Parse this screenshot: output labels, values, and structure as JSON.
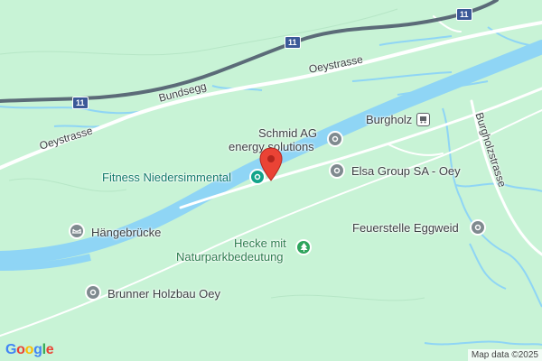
{
  "map": {
    "roads": {
      "oeystrasse_left": "Oeystrasse",
      "bundsegg": "Bundsegg",
      "oeystrasse_top": "Oeystrasse",
      "burgholzstrasse": "Burgholzstrasse"
    },
    "shields": [
      "11",
      "11",
      "11"
    ],
    "places": {
      "burgholz": "Burgholz",
      "schmid_line1": "Schmid AG",
      "schmid_line2": "energy solutions",
      "fitness": "Fitness Niedersimmental",
      "elsa": "Elsa Group SA - Oey",
      "feuerstelle": "Feuerstelle Eggweid",
      "haengebruecke": "Hängebrücke",
      "hecke_line1": "Hecke mit",
      "hecke_line2": "Naturparkbedeutung",
      "brunner": "Brunner Holzbau Oey"
    },
    "icons": {
      "schmid": "location-pin-icon",
      "fitness": "fitness-icon",
      "elsa": "location-pin-icon",
      "feuerstelle": "location-pin-icon",
      "haengebruecke": "bridge-icon",
      "hecke": "tree-icon",
      "brunner": "location-pin-icon",
      "burgholz": "bus-stop-icon",
      "selected": "red-marker-icon"
    },
    "colors": {
      "land": "#c8f3d6",
      "water": "#8fd5f5",
      "highway": "#5b6b78",
      "selected_marker": "#ea4335"
    }
  },
  "branding": {
    "google": "Google",
    "attribution": "Map data ©2025"
  }
}
